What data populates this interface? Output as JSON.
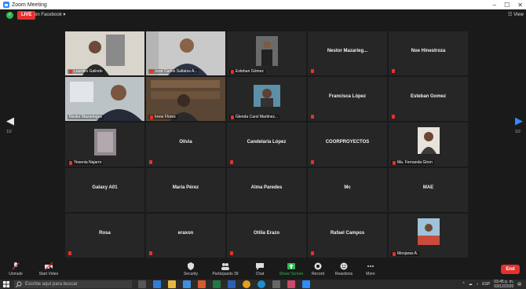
{
  "window": {
    "title": "Zoom Meeting",
    "minimize": "–",
    "maximize": "☐",
    "close": "✕"
  },
  "topbar": {
    "live": "LIVE",
    "on_facebook": "on Facebook ▾",
    "view": "☷ View"
  },
  "pager": {
    "left": "1/2",
    "right": "1/2"
  },
  "tiles": [
    {
      "name": "",
      "label": "Lourdes Galindo",
      "video": "lourdes"
    },
    {
      "name": "",
      "label": "José Carlos Saltatos A...",
      "video": "jose"
    },
    {
      "name": "",
      "label": "Esteban Gómez",
      "video": "esteban_photo"
    },
    {
      "name": "Nestor  Mazarieg...",
      "label": "",
      "video": ""
    },
    {
      "name": "Noe Hinestroza",
      "label": "",
      "video": ""
    },
    {
      "name": "",
      "label": "Nestor Mazariegos",
      "video": "nestor"
    },
    {
      "name": "",
      "label": "Irene Flores",
      "video": "irene"
    },
    {
      "name": "",
      "label": "Glenda Carol Martinez...",
      "video": "glenda"
    },
    {
      "name": "Francisca López",
      "label": "",
      "video": ""
    },
    {
      "name": "Esteban Gomez",
      "label": "",
      "video": ""
    },
    {
      "name": "",
      "label": "Yesenia Najarro",
      "video": "yesenia"
    },
    {
      "name": "Olivia",
      "label": "",
      "video": ""
    },
    {
      "name": "Candelaria López",
      "label": "",
      "video": ""
    },
    {
      "name": "COORPROYECTOS",
      "label": "",
      "video": ""
    },
    {
      "name": "",
      "label": "Ma. Fernanda Giron",
      "video": "fernanda"
    },
    {
      "name": "Galaxy A01",
      "label": "",
      "video": ""
    },
    {
      "name": "María Pérez",
      "label": "",
      "video": ""
    },
    {
      "name": "Alma Paredes",
      "label": "",
      "video": ""
    },
    {
      "name": "Mc",
      "label": "",
      "video": ""
    },
    {
      "name": "MAE",
      "label": "",
      "video": ""
    },
    {
      "name": "Rosa",
      "label": "",
      "video": ""
    },
    {
      "name": "eraxon",
      "label": "",
      "video": ""
    },
    {
      "name": "Otilia Erazo",
      "label": "",
      "video": ""
    },
    {
      "name": "Rafael Campos",
      "label": "",
      "video": ""
    },
    {
      "name": "",
      "label": "Monjaras A.",
      "video": "monjaras"
    }
  ],
  "controls": {
    "unmute": "Unmute",
    "start_video": "Start Video",
    "security": "Security",
    "participants": "Participants",
    "participants_count": "39",
    "chat": "Chat",
    "share_screen": "Share Screen",
    "record": "Record",
    "reactions": "Reactions",
    "more": "More",
    "end": "End"
  },
  "taskbar": {
    "search_placeholder": "Escribe aquí para buscar",
    "lang": "ESP",
    "time": "03:45 p. m.",
    "date": "03/12/2020"
  },
  "colors": {
    "accent": "#2d8cff",
    "live_red": "#e5322d",
    "active_speaker": "#c8e24c",
    "share_green": "#2eb84f"
  }
}
